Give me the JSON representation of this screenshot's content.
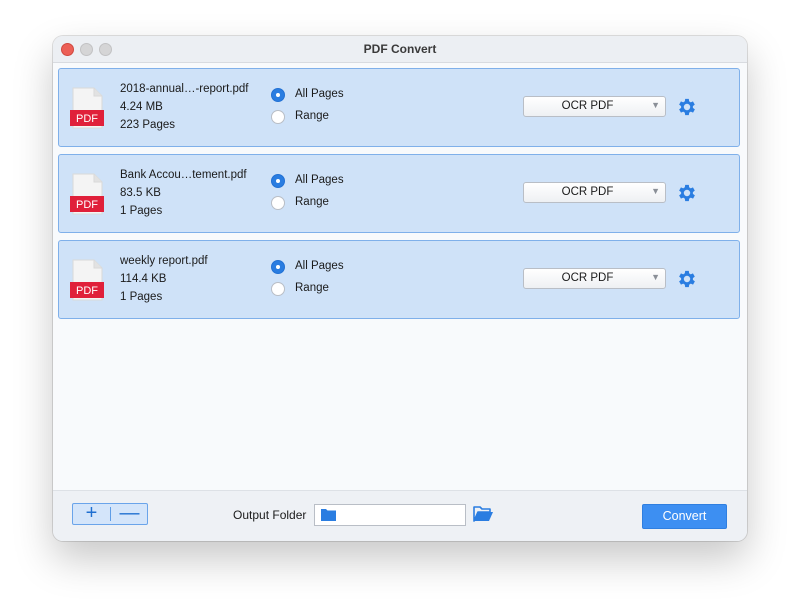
{
  "window": {
    "title": "PDF Convert"
  },
  "files": [
    {
      "name": "2018-annual…-report.pdf",
      "size": "4.24 MB",
      "pages": "223 Pages",
      "icon_label": "PDF",
      "page_option_all": "All Pages",
      "page_option_range": "Range",
      "selected_option": "All Pages",
      "format": "OCR PDF"
    },
    {
      "name": "Bank Accou…tement.pdf",
      "size": "83.5 KB",
      "pages": "1 Pages",
      "icon_label": "PDF",
      "page_option_all": "All Pages",
      "page_option_range": "Range",
      "selected_option": "All Pages",
      "format": "OCR PDF"
    },
    {
      "name": "weekly report.pdf",
      "size": "114.4 KB",
      "pages": "1 Pages",
      "icon_label": "PDF",
      "page_option_all": "All Pages",
      "page_option_range": "Range",
      "selected_option": "All Pages",
      "format": "OCR PDF"
    }
  ],
  "bottom": {
    "add_label": "+",
    "remove_label": "—",
    "output_folder_label": "Output Folder",
    "output_folder_value": "",
    "convert_label": "Convert"
  },
  "colors": {
    "accent": "#2a7de1",
    "row_background": "#cfe2f8",
    "row_border": "#7fb0ea",
    "pdf_red": "#e0203a",
    "convert_button": "#3d8ff2"
  },
  "icons": {
    "file": "pdf-file-icon",
    "settings": "gear-icon",
    "dropdown": "chevron-down-icon",
    "folder": "folder-icon",
    "browse": "open-folder-icon"
  }
}
